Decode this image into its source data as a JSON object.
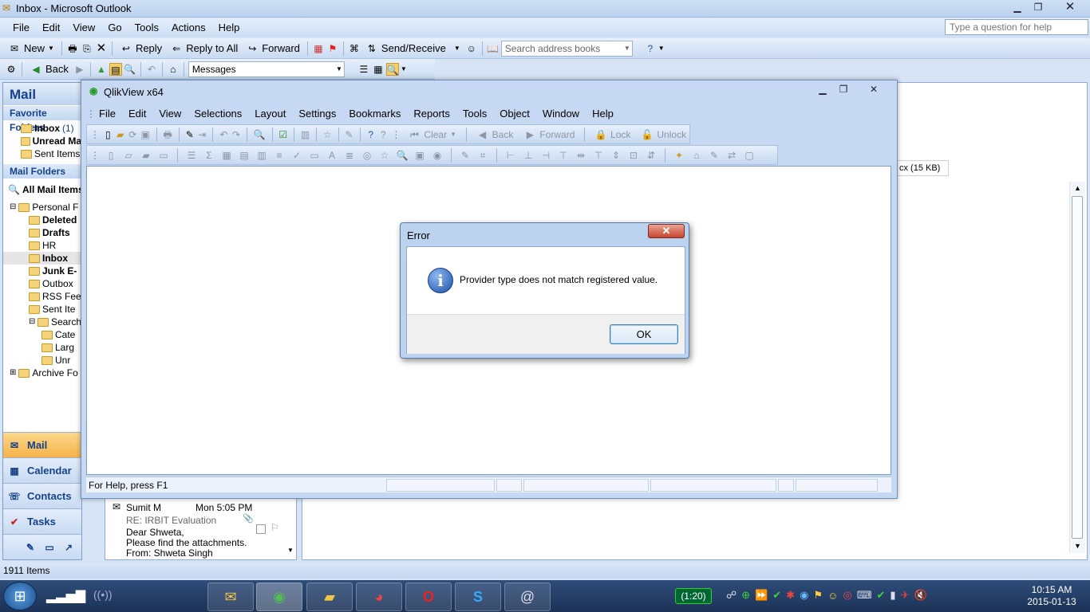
{
  "outlook": {
    "title": "Inbox - Microsoft Outlook",
    "menu": [
      "File",
      "Edit",
      "View",
      "Go",
      "Tools",
      "Actions",
      "Help"
    ],
    "help_placeholder": "Type a question for help",
    "toolbar1": {
      "new": "New",
      "reply": "Reply",
      "reply_all": "Reply to All",
      "forward": "Forward",
      "send_receive": "Send/Receive",
      "search_placeholder": "Search address books"
    },
    "toolbar2": {
      "back": "Back",
      "view_select": "Messages"
    },
    "nav": {
      "header": "Mail",
      "favorite_folders": "Favorite Folders",
      "favorites": [
        {
          "label": "Inbox",
          "count": "(1)",
          "bold": true
        },
        {
          "label": "Unread Ma",
          "bold": true
        },
        {
          "label": "Sent Items",
          "bold": false
        }
      ],
      "mail_folders": "Mail Folders",
      "all_mail_items": "All Mail Items",
      "tree": [
        {
          "label": "Personal F",
          "indent": 0,
          "bold": false
        },
        {
          "label": "Deleted",
          "indent": 1,
          "bold": true
        },
        {
          "label": "Drafts",
          "indent": 1,
          "bold": true
        },
        {
          "label": "HR",
          "indent": 1,
          "bold": false
        },
        {
          "label": "Inbox",
          "indent": 1,
          "bold": true
        },
        {
          "label": "Junk E-",
          "indent": 1,
          "bold": true
        },
        {
          "label": "Outbox",
          "indent": 1,
          "bold": false
        },
        {
          "label": "RSS Fee",
          "indent": 1,
          "bold": false
        },
        {
          "label": "Sent Ite",
          "indent": 1,
          "bold": false
        },
        {
          "label": "Search",
          "indent": 1,
          "bold": false
        },
        {
          "label": "Cate",
          "indent": 2,
          "bold": false
        },
        {
          "label": "Larg",
          "indent": 2,
          "bold": false
        },
        {
          "label": "Unr",
          "indent": 2,
          "bold": false
        },
        {
          "label": "Archive Fo",
          "indent": 0,
          "bold": false
        }
      ],
      "bottom": [
        {
          "label": "Mail"
        },
        {
          "label": "Calendar"
        },
        {
          "label": "Contacts"
        },
        {
          "label": "Tasks"
        }
      ]
    },
    "mail_item": {
      "sender": "Sumit M",
      "time": "Mon 5:05 PM",
      "subject": "RE: IRBIT Evaluation",
      "line1": "Dear Shweta,",
      "line2": "Please find the attachments.",
      "line3": "From: Shweta Singh"
    },
    "attachment_hint": "cx (15 KB)",
    "status": "1911 Items"
  },
  "qlikview": {
    "title": "QlikView x64",
    "menu": [
      "File",
      "Edit",
      "View",
      "Selections",
      "Layout",
      "Settings",
      "Bookmarks",
      "Reports",
      "Tools",
      "Object",
      "Window",
      "Help"
    ],
    "toolbar": {
      "clear": "Clear",
      "back": "Back",
      "forward": "Forward",
      "lock": "Lock",
      "unlock": "Unlock"
    },
    "status": "For Help, press F1"
  },
  "error_dialog": {
    "title": "Error",
    "message": "Provider type does not match registered value.",
    "ok": "OK"
  },
  "taskbar": {
    "battery": "(1:20)",
    "time": "10:15 AM",
    "date": "2015-01-13"
  }
}
